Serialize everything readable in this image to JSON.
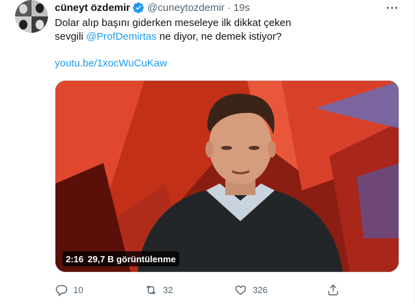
{
  "tweet": {
    "author_name": "cüneyt özdemir",
    "author_handle": "@cuneytozdemir",
    "separator": "·",
    "time": "19s",
    "text_line1": "Dolar alıp başını giderken meseleye ilk dikkat çeken",
    "text_prefix": "sevgili ",
    "mention": "@ProfDemirtas",
    "text_suffix": " ne diyor, ne demek istiyor?",
    "link": "youtu.be/1xocWuCuKaw"
  },
  "video": {
    "duration": "2:16",
    "views": "29,7 B görüntülenme"
  },
  "actions": {
    "reply_count": "10",
    "retweet_count": "32",
    "like_count": "326"
  },
  "colors": {
    "link": "#1d9bf0",
    "secondary_text": "#536471",
    "primary_text": "#0f1419"
  },
  "icons": [
    "verified-badge-icon",
    "more-icon",
    "reply-icon",
    "retweet-icon",
    "like-icon",
    "share-icon"
  ]
}
